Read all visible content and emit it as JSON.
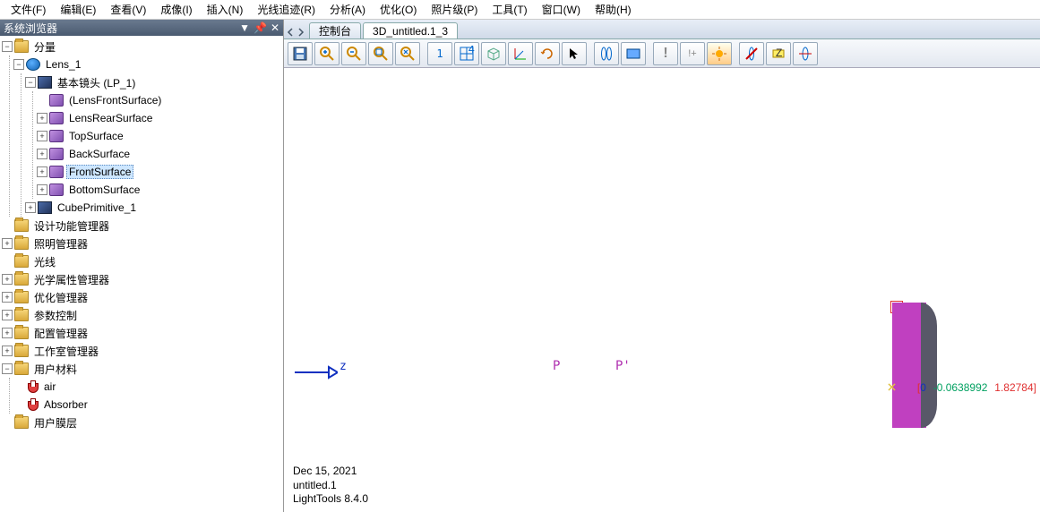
{
  "menu": {
    "file": "文件(F)",
    "edit": "编辑(E)",
    "view": "查看(V)",
    "image": "成像(I)",
    "insert": "插入(N)",
    "ray": "光线追迹(R)",
    "analysis": "分析(A)",
    "opt": "优化(O)",
    "photo": "照片级(P)",
    "tools": "工具(T)",
    "window": "窗口(W)",
    "help": "帮助(H)"
  },
  "sidebar": {
    "title": "系统浏览器",
    "root": "分量",
    "lens": "Lens_1",
    "baselens": "基本镜头 (LP_1)",
    "surfaces": {
      "front_paren": "(LensFrontSurface)",
      "rear": "LensRearSurface",
      "top": "TopSurface",
      "back": "BackSurface",
      "front": "FrontSurface",
      "bottom": "BottomSurface"
    },
    "cube": "CubePrimitive_1",
    "managers": {
      "design": "设计功能管理器",
      "illum": "照明管理器",
      "ray": "光线",
      "optprop": "光学属性管理器",
      "optmgr": "优化管理器",
      "param": "参数控制",
      "config": "配置管理器",
      "studio": "工作室管理器",
      "usermat": "用户材料",
      "usercoat": "用户膜层"
    },
    "materials": {
      "air": "air",
      "absorber": "Absorber"
    }
  },
  "tabs": {
    "console": "控制台",
    "view3d": "3D_untitled.1_3"
  },
  "viewport": {
    "axis_label": "z",
    "P": "P",
    "Pprime": "P'",
    "coord_open": "[",
    "coord_v1": "0",
    "coord_v2": "-0.0638992",
    "coord_v3": "1.82784",
    "coord_close": "]",
    "footer_date": "Dec 15, 2021",
    "footer_name": "untitled.1",
    "footer_app": "LightTools 8.4.0"
  },
  "toolbar": {
    "num1": "1",
    "num4": "4"
  }
}
